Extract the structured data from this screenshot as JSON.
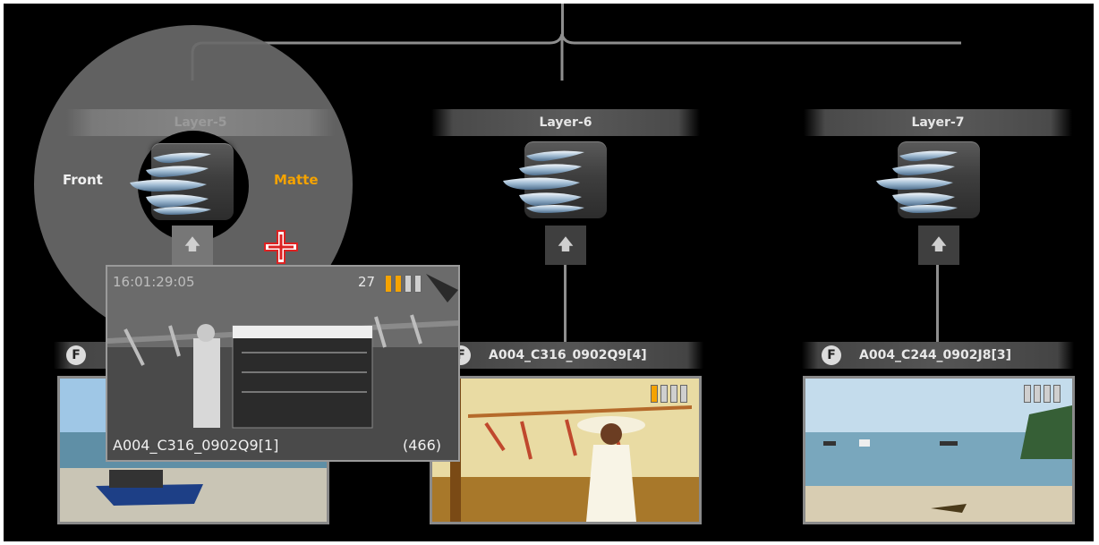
{
  "layers": [
    {
      "name": "Layer-5"
    },
    {
      "name": "Layer-6"
    },
    {
      "name": "Layer-7"
    }
  ],
  "radial_menu": {
    "front_label": "Front",
    "matte_label": "Matte"
  },
  "clips": [
    {
      "name": ""
    },
    {
      "name": "A004_C316_0902Q9[4]",
      "segments_filled": 1,
      "segments_total": 4
    },
    {
      "name": "A004_C244_0902J8[3]",
      "segments_filled": 0,
      "segments_total": 4
    }
  ],
  "drag_preview": {
    "timecode": "16:01:29:05",
    "frame": "27",
    "segments_filled": 2,
    "segments_total": 4,
    "clip_name": "A004_C316_0902Q9[1]",
    "length": "(466)"
  },
  "icons": {
    "up_arrow": "🡅",
    "f_badge": "F"
  },
  "colors": {
    "accent_orange": "#f5a300",
    "background": "#000000",
    "wire": "#8e8e8e"
  }
}
